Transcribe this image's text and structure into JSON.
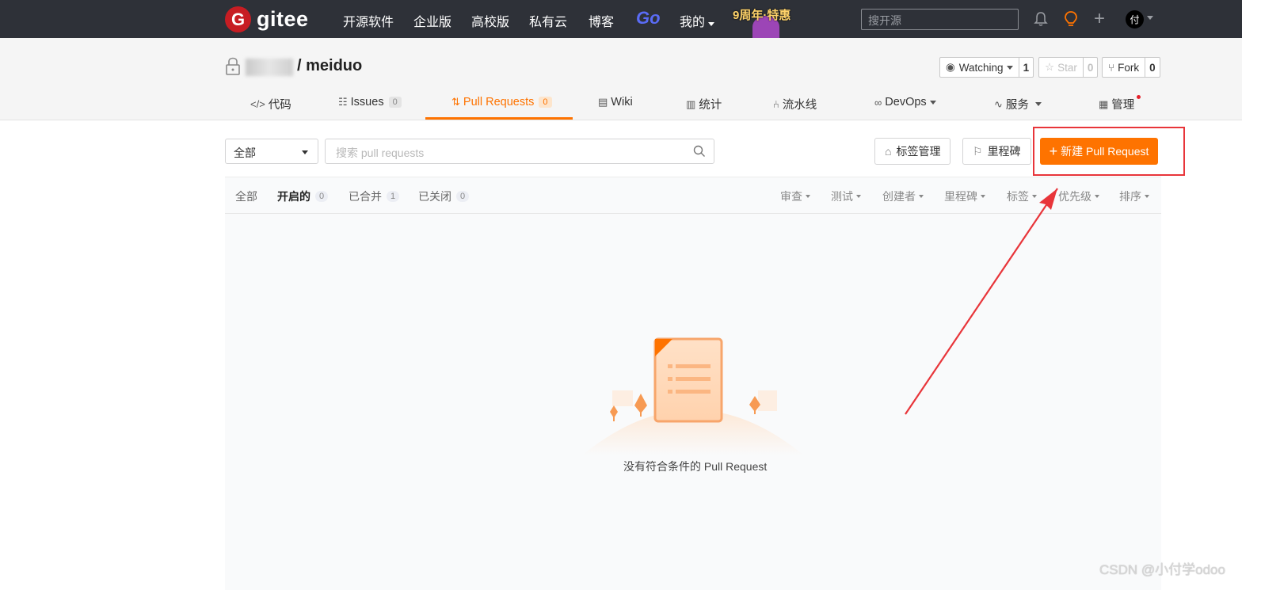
{
  "topnav": {
    "logo_letter": "G",
    "logo_text": "gitee",
    "items": [
      "开源软件",
      "企业版",
      "高校版",
      "私有云",
      "博客"
    ],
    "go_label": "Go",
    "mine_label": "我的",
    "promo_label": "9周年·特惠",
    "search_placeholder": "搜开源",
    "avatar_initial": "付"
  },
  "repo": {
    "name": "/ meiduo",
    "watching_label": "Watching",
    "watching_count": "1",
    "star_label": "Star",
    "star_count": "0",
    "fork_label": "Fork",
    "fork_count": "0"
  },
  "tabs": [
    {
      "label": "代码"
    },
    {
      "label": "Issues",
      "badge": "0"
    },
    {
      "label": "Pull Requests",
      "badge": "0",
      "active": true
    },
    {
      "label": "Wiki"
    },
    {
      "label": "统计"
    },
    {
      "label": "流水线"
    },
    {
      "label": "DevOps"
    },
    {
      "label": "服务"
    },
    {
      "label": "管理"
    }
  ],
  "filters": {
    "scope_select": "全部",
    "search_placeholder": "搜索 pull requests",
    "labels_button": "标签管理",
    "milestones_button": "里程碑",
    "new_pr_button": "新建 Pull Request"
  },
  "states": [
    {
      "label": "全部"
    },
    {
      "label": "开启的",
      "count": "0",
      "active": true
    },
    {
      "label": "已合并",
      "count": "1"
    },
    {
      "label": "已关闭",
      "count": "0"
    }
  ],
  "filter_menus": [
    "审查",
    "测试",
    "创建者",
    "里程碑",
    "标签",
    "优先级",
    "排序"
  ],
  "empty_state": {
    "message": "没有符合条件的 Pull Request"
  },
  "watermark": "CSDN @小付学odoo",
  "colors": {
    "accent": "#fe7300",
    "nav_bg": "#2e3138",
    "brand_red": "#c71d23",
    "annotation_red": "#e8353a"
  }
}
